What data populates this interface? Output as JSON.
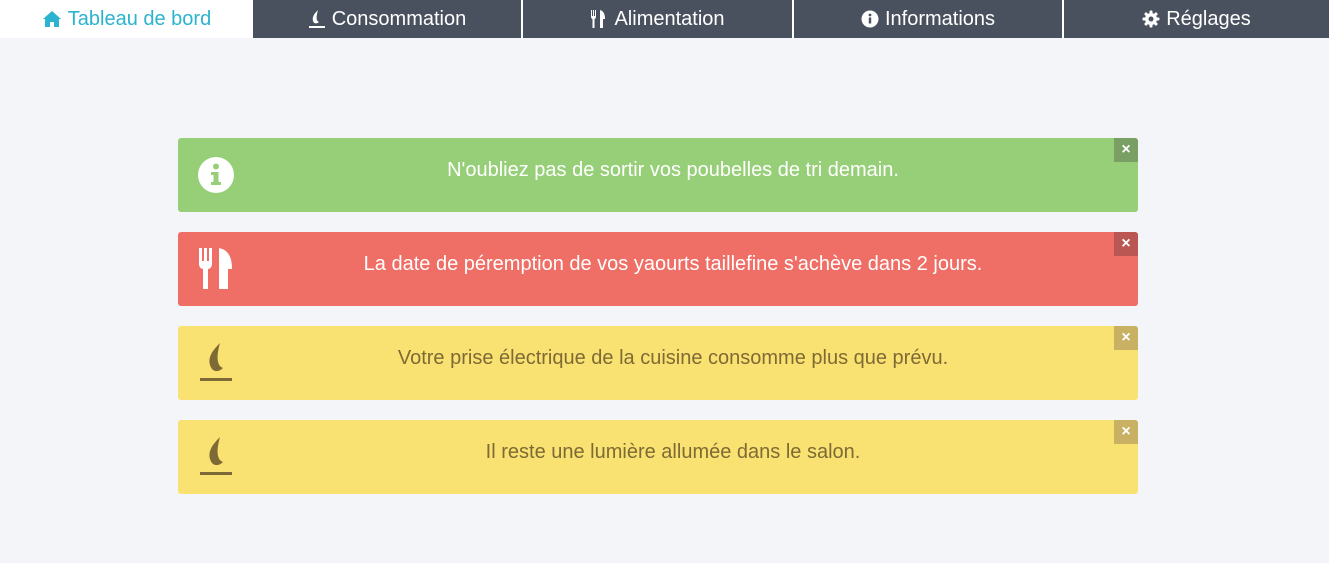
{
  "nav": {
    "tabs": [
      {
        "label": "Tableau de bord",
        "icon": "home-icon",
        "active": true
      },
      {
        "label": "Consommation",
        "icon": "flame-icon",
        "active": false
      },
      {
        "label": "Alimentation",
        "icon": "utensils-icon",
        "active": false
      },
      {
        "label": "Informations",
        "icon": "info-icon",
        "active": false
      },
      {
        "label": "Réglages",
        "icon": "gear-icon",
        "active": false
      }
    ]
  },
  "alerts": [
    {
      "type": "info",
      "color": "#97cf79",
      "icon": "info-circle-icon",
      "text": "N'oubliez pas de sortir vos poubelles de tri demain.",
      "close": "×"
    },
    {
      "type": "food",
      "color": "#ef6e66",
      "icon": "utensils-icon",
      "text": "La date de péremption de vos yaourts taillefine s'achève dans 2 jours.",
      "close": "×"
    },
    {
      "type": "energy",
      "color": "#fae272",
      "icon": "flame-icon",
      "text": "Votre prise électrique de la cuisine consomme plus que prévu.",
      "close": "×"
    },
    {
      "type": "energy",
      "color": "#fae272",
      "icon": "flame-icon",
      "text": "Il reste une lumière allumée dans le salon.",
      "close": "×"
    }
  ],
  "colors": {
    "nav_bg": "#4a515e",
    "active_tab_text": "#2bb3cf",
    "page_bg": "#f4f5f9"
  }
}
